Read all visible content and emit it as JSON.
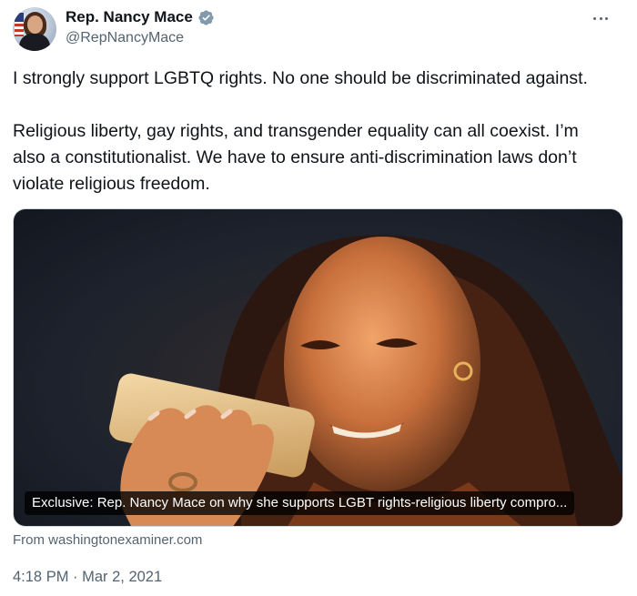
{
  "author": {
    "display_name": "Rep. Nancy Mace",
    "handle": "@RepNancyMace",
    "verified_icon": "verified-badge-icon",
    "avatar_icon": "profile-photo"
  },
  "more_icon": "more-options-icon",
  "tweet": {
    "lines": [
      "I strongly support LGBTQ rights. No one should be discriminated against.",
      "Religious liberty, gay rights, and transgender equality can all coexist. I’m",
      "also a constitutionalist. We have to ensure anti-discrimination laws don’t",
      "violate religious freedom."
    ]
  },
  "link_card": {
    "title": "Exclusive: Rep. Nancy Mace on why she supports LGBT rights-religious liberty compro...",
    "source": "From washingtonexaminer.com"
  },
  "timestamp": "4:18 PM · Mar 2, 2021",
  "colors": {
    "text_primary": "#0f1419",
    "text_secondary": "#536471",
    "verified_badge": "#829aab"
  }
}
